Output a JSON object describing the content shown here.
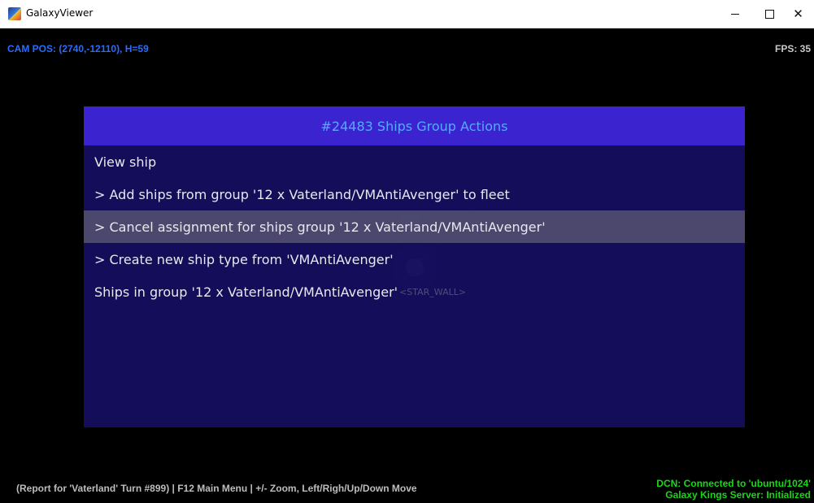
{
  "window": {
    "title": "GalaxyViewer",
    "minimize_icon": "minimize-icon",
    "maximize_icon": "maximize-icon",
    "close_icon": "close-icon",
    "close_glyph": "✕"
  },
  "hud": {
    "cam_pos": "CAM POS: (2740,-12110), H=59",
    "fps": "FPS: 35",
    "star_label": "<STAR_WALL>"
  },
  "dialog": {
    "title": "#24483 Ships Group Actions",
    "items": [
      {
        "label": "View ship",
        "selected": false
      },
      {
        "label": "> Add ships from group '12 x Vaterland/VMAntiAvenger' to fleet",
        "selected": false
      },
      {
        "label": "> Cancel assignment for ships group '12 x Vaterland/VMAntiAvenger'",
        "selected": true
      },
      {
        "label": "> Create new ship type from 'VMAntiAvenger'",
        "selected": false
      },
      {
        "label": "Ships in group '12 x Vaterland/VMAntiAvenger'",
        "selected": false
      }
    ]
  },
  "status": {
    "left": "(Report for 'Vaterland' Turn #899) | F12 Main Menu | +/- Zoom, Left/Righ/Up/Down Move",
    "right_line1": "DCN: Connected to 'ubuntu/1024'",
    "right_line2": "Galaxy Kings Server: Initialized"
  },
  "colors": {
    "header_bg": "#3b24cf",
    "header_text": "#58a8ff",
    "campos_text": "#2a6cff",
    "connected_text": "#18d818"
  }
}
